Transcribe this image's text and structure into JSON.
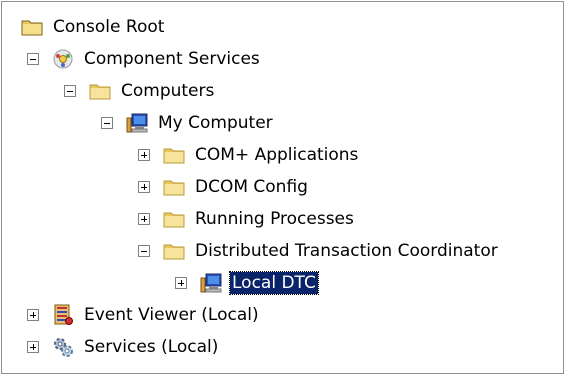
{
  "tree": {
    "console_root": "Console Root",
    "component_services": "Component Services",
    "computers": "Computers",
    "my_computer": "My Computer",
    "com_plus_applications": "COM+ Applications",
    "dcom_config": "DCOM Config",
    "running_processes": "Running Processes",
    "distributed_transaction_coordinator": "Distributed Transaction Coordinator",
    "local_dtc": "Local DTC",
    "event_viewer": "Event Viewer (Local)",
    "services": "Services (Local)"
  },
  "colors": {
    "selection_bg": "#0a246a",
    "folder_yellow": "#f3d675"
  }
}
